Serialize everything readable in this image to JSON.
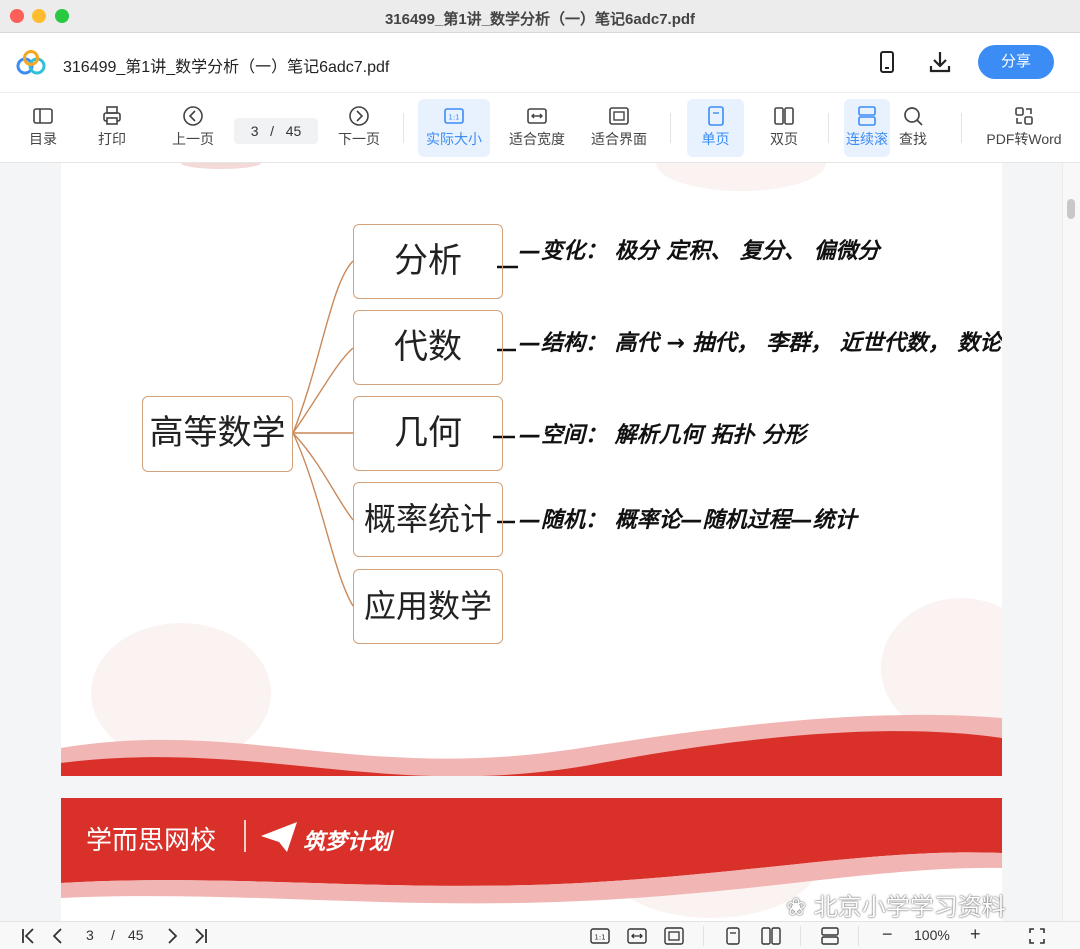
{
  "window": {
    "title": "316499_第1讲_数学分析（一）笔记6adc7.pdf"
  },
  "appbar": {
    "doc_title": "316499_第1讲_数学分析（一）笔记6adc7.pdf",
    "share_label": "分享"
  },
  "toolbar": {
    "toc": "目录",
    "print": "打印",
    "prev": "上一页",
    "next": "下一页",
    "current_page": "3",
    "page_sep": "/",
    "total_pages": "45",
    "actual_size": "实际大小",
    "fit_width": "适合宽度",
    "fit_page": "适合界面",
    "single": "单页",
    "double": "双页",
    "continuous": "连续滚",
    "find": "查找",
    "pdf_to_word": "PDF转Word"
  },
  "mindmap": {
    "root": "高等数学",
    "branches": [
      {
        "label": "分析",
        "note": "—变化： 极分 定积、 复分、 偏微分"
      },
      {
        "label": "代数",
        "note": "—结构： 高代 → 抽代， 李群， 近世代数， 数论"
      },
      {
        "label": "几何",
        "note": "—空间： 解析几何 拓扑 分形"
      },
      {
        "label": "概率统计",
        "note": "—随机： 概率论—随机过程—统计"
      },
      {
        "label": "应用数学",
        "note": ""
      }
    ]
  },
  "footer_banner": {
    "brand": "学而思网校",
    "slogan": "筑梦计划"
  },
  "statusbar": {
    "current_page": "3",
    "sep": "/",
    "total_pages": "45",
    "zoom": "100%"
  },
  "watermark": "北京小学学习资料",
  "colors": {
    "accent": "#3b8cf5",
    "brand_red": "#d9302a",
    "node_border": "#d2a27a"
  }
}
